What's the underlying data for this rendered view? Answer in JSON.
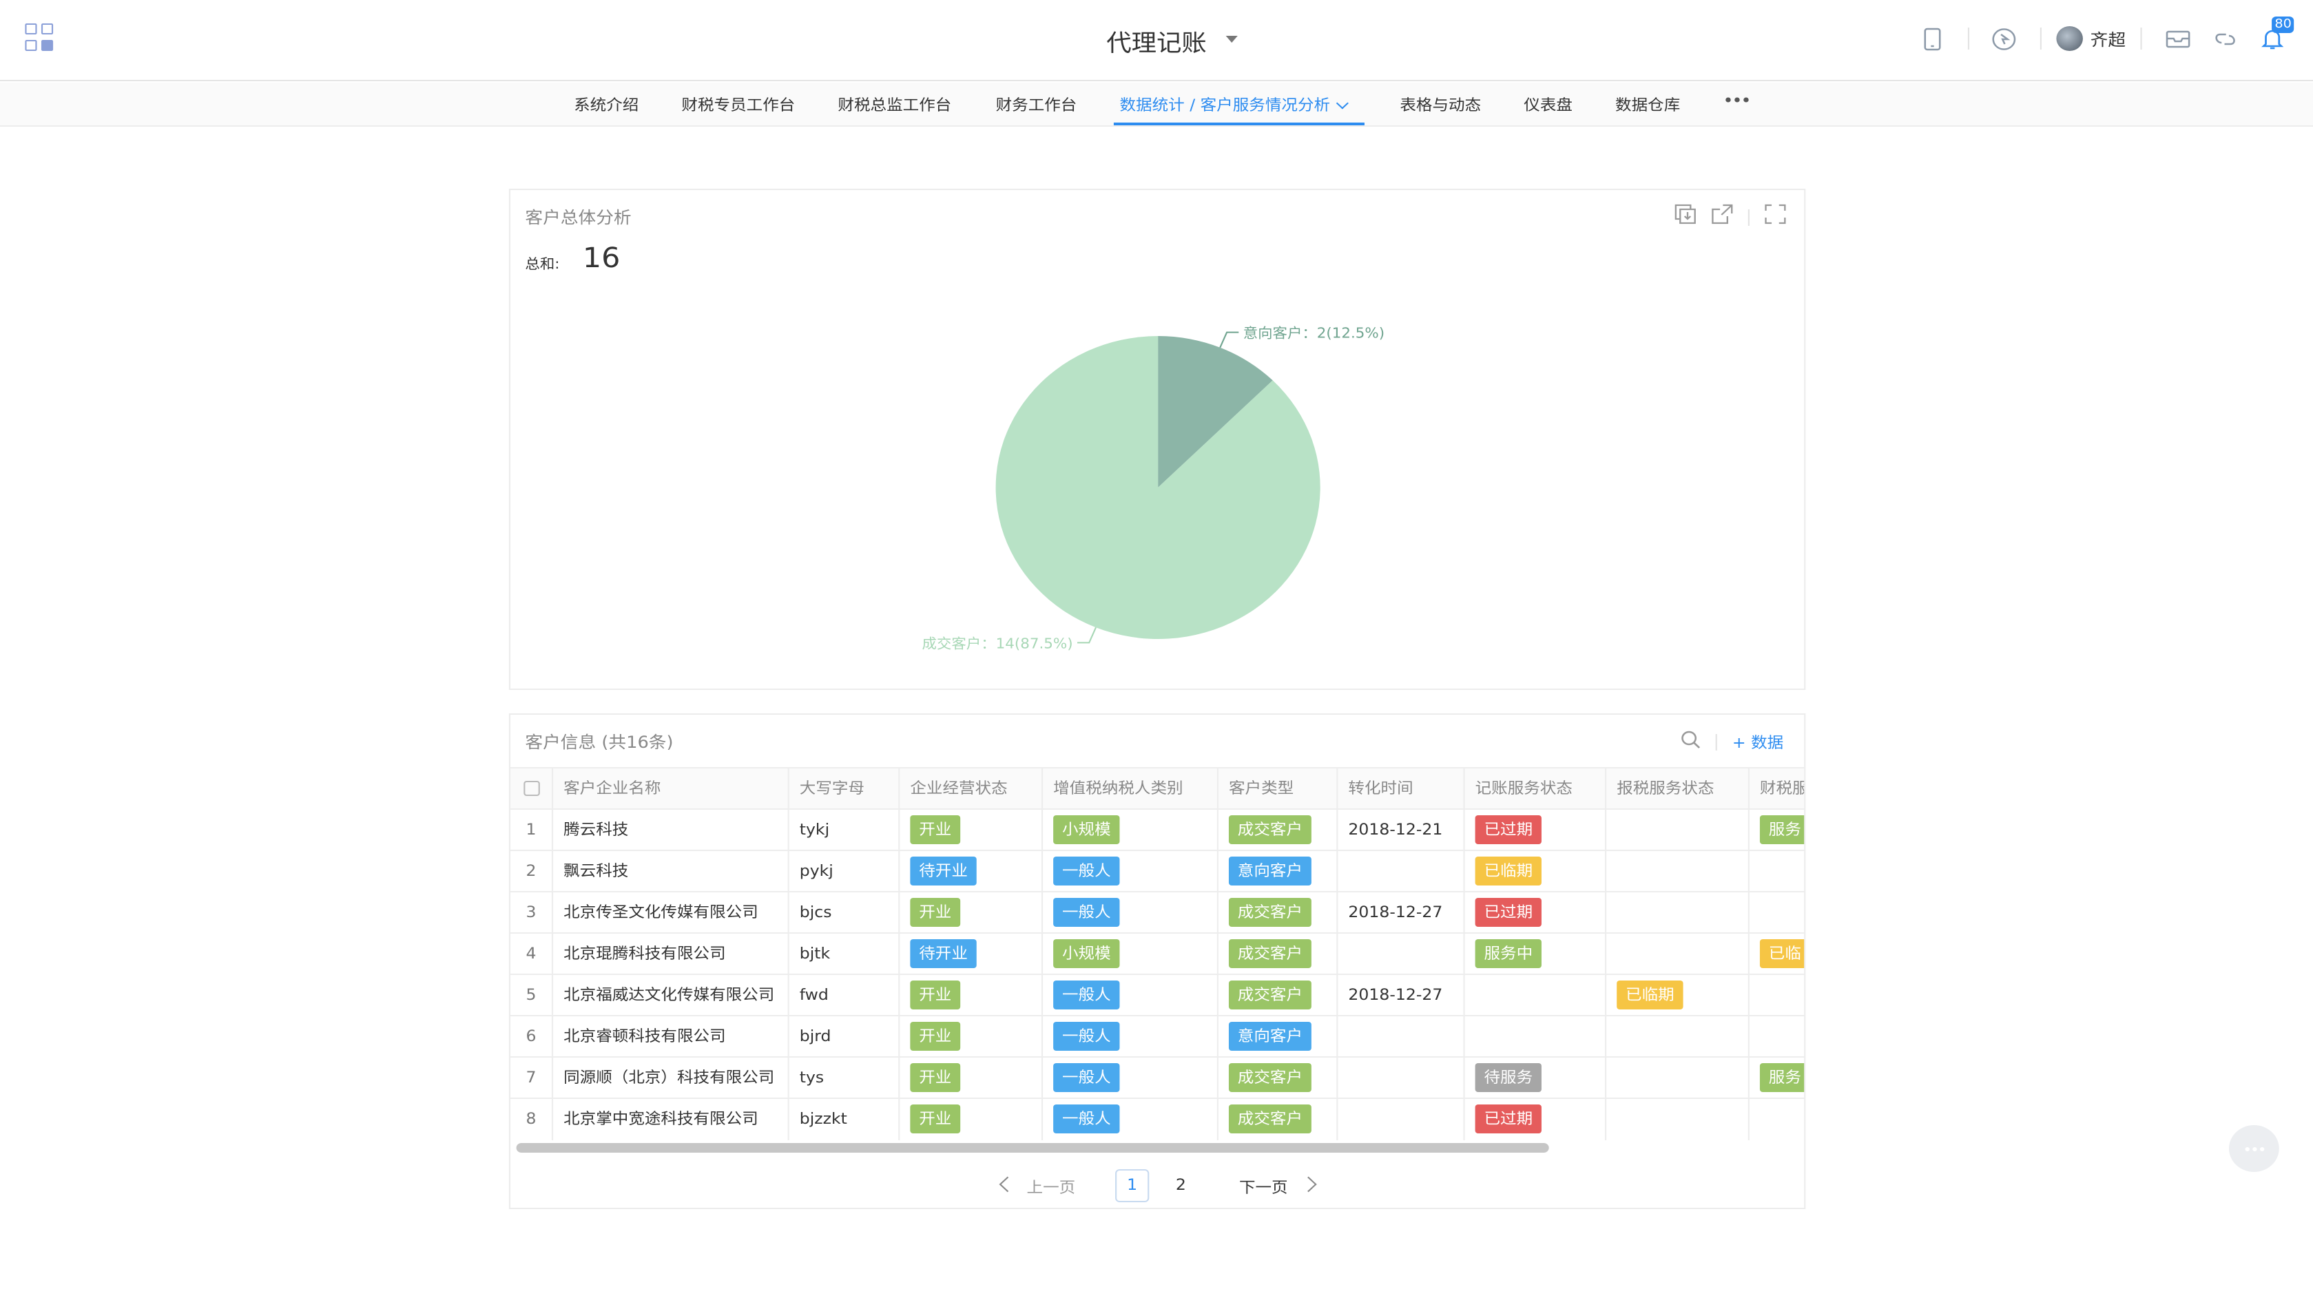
{
  "header": {
    "title": "代理记账",
    "user_name": "齐超",
    "notification_count": "80"
  },
  "nav": {
    "items": [
      "系统介绍",
      "财税专员工作台",
      "财税总监工作台",
      "财务工作台",
      "数据统计 / 客户服务情况分析",
      "表格与动态",
      "仪表盘",
      "数据仓库"
    ],
    "active_index": 4,
    "more": "•••"
  },
  "chart_card": {
    "title": "客户总体分析",
    "sum_label": "总和:",
    "sum_value": "16"
  },
  "chart_data": {
    "type": "pie",
    "categories": [
      "意向客户",
      "成交客户"
    ],
    "values": [
      2,
      14
    ],
    "percents": [
      "12.5%",
      "87.5%"
    ],
    "labels": [
      "意向客户：2(12.5%)",
      "成交客户：14(87.5%)"
    ],
    "colors": [
      "#8cb5a7",
      "#b8e2c6"
    ],
    "label_colors": [
      "#6fa48f",
      "#a7d7b5"
    ]
  },
  "table": {
    "title": "客户信息 (共16条)",
    "add_label": "+ 数据",
    "columns": [
      "客户企业名称",
      "大写字母",
      "企业经营状态",
      "增值税纳税人类别",
      "客户类型",
      "转化时间",
      "记账服务状态",
      "报税服务状态",
      "财税服"
    ],
    "rows": [
      {
        "no": "1",
        "name": "腾云科技",
        "abbr": "tykj",
        "biz": "开业",
        "vat": "小规模",
        "type": "成交客户",
        "date": "2018-12-21",
        "bk": "已过期",
        "tax": "",
        "fin": "服务"
      },
      {
        "no": "2",
        "name": "飘云科技",
        "abbr": "pykj",
        "biz": "待开业",
        "vat": "一般人",
        "type": "意向客户",
        "date": "",
        "bk": "已临期",
        "tax": "",
        "fin": ""
      },
      {
        "no": "3",
        "name": "北京传圣文化传媒有限公司",
        "abbr": "bjcs",
        "biz": "开业",
        "vat": "一般人",
        "type": "成交客户",
        "date": "2018-12-27",
        "bk": "已过期",
        "tax": "",
        "fin": ""
      },
      {
        "no": "4",
        "name": "北京琨腾科技有限公司",
        "abbr": "bjtk",
        "biz": "待开业",
        "vat": "小规模",
        "type": "成交客户",
        "date": "",
        "bk": "服务中",
        "tax": "",
        "fin": "已临"
      },
      {
        "no": "5",
        "name": "北京福威达文化传媒有限公司",
        "abbr": "fwd",
        "biz": "开业",
        "vat": "一般人",
        "type": "成交客户",
        "date": "2018-12-27",
        "bk": "",
        "tax": "已临期",
        "fin": ""
      },
      {
        "no": "6",
        "name": "北京睿顿科技有限公司",
        "abbr": "bjrd",
        "biz": "开业",
        "vat": "一般人",
        "type": "意向客户",
        "date": "",
        "bk": "",
        "tax": "",
        "fin": ""
      },
      {
        "no": "7",
        "name": "同源顺（北京）科技有限公司",
        "abbr": "tys",
        "biz": "开业",
        "vat": "一般人",
        "type": "成交客户",
        "date": "",
        "bk": "待服务",
        "tax": "",
        "fin": "服务"
      },
      {
        "no": "8",
        "name": "北京掌中宽途科技有限公司",
        "abbr": "bjzzkt",
        "biz": "开业",
        "vat": "一般人",
        "type": "成交客户",
        "date": "",
        "bk": "已过期",
        "tax": "",
        "fin": ""
      }
    ]
  },
  "pager": {
    "prev": "上一页",
    "next": "下一页",
    "pages": [
      "1",
      "2"
    ],
    "current": "1"
  }
}
